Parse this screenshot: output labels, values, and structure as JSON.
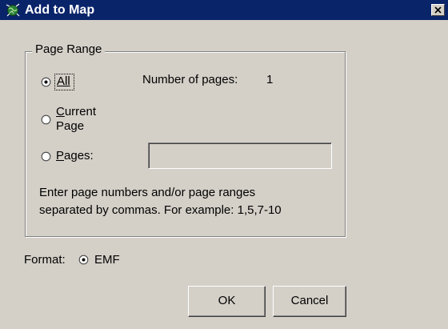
{
  "window": {
    "title": "Add to Map",
    "close_glyph": "×",
    "title_bar_color": "#0a246a"
  },
  "page_range": {
    "legend": "Page Range",
    "options": [
      {
        "label": "All",
        "mnemonic_underlined": true,
        "selected": true
      },
      {
        "label_line1": "Current",
        "label_line2": "Page",
        "selected": false
      },
      {
        "label": "Pages:",
        "selected": false
      }
    ],
    "number_of_pages_label": "Number of pages:",
    "number_of_pages_value": "1",
    "pages_input_value": "",
    "help_line1": "Enter page numbers and/or page ranges",
    "help_line2": "separated by commas. For example: 1,5,7-10"
  },
  "format": {
    "label": "Format:",
    "option_label": "EMF",
    "selected": true
  },
  "buttons": {
    "ok": "OK",
    "cancel": "Cancel"
  },
  "icons": {
    "app": "globe-map-icon",
    "close": "close-icon",
    "radio_selected": "radio-selected-icon",
    "radio_unselected": "radio-unselected-icon"
  }
}
